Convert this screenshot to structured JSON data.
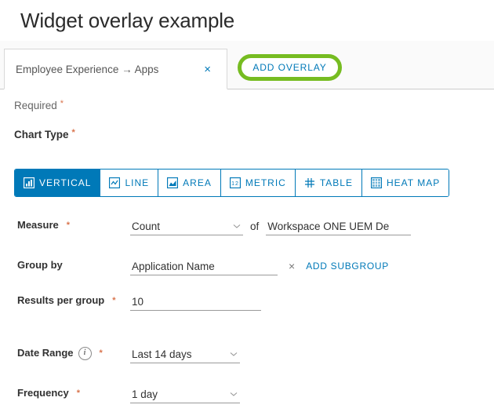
{
  "page": {
    "title": "Widget overlay example"
  },
  "tabs": {
    "active_label": "Employee Experience → Apps",
    "close_icon": "×",
    "add_overlay_label": "ADD OVERLAY",
    "highlight_color": "#76bc21",
    "accent_color": "#0079b8"
  },
  "form": {
    "required_note": "Required",
    "required_marker": "*",
    "chart_type_label": "Chart Type",
    "chart_types": [
      {
        "label": "VERTICAL",
        "icon": "bar-chart-icon",
        "selected": true
      },
      {
        "label": "LINE",
        "icon": "line-chart-icon",
        "selected": false
      },
      {
        "label": "AREA",
        "icon": "area-chart-icon",
        "selected": false
      },
      {
        "label": "METRIC",
        "icon": "metric-number-icon",
        "selected": false
      },
      {
        "label": "TABLE",
        "icon": "table-grid-icon",
        "selected": false
      },
      {
        "label": "HEAT MAP",
        "icon": "heat-map-icon",
        "selected": false
      }
    ],
    "measure": {
      "label": "Measure",
      "value": "Count",
      "of_text": "of",
      "target_value": "Workspace ONE UEM De"
    },
    "group_by": {
      "label": "Group by",
      "value": "Application Name",
      "clear_icon": "×",
      "add_subgroup_label": "ADD SUBGROUP"
    },
    "results_per_group": {
      "label": "Results per group",
      "value": "10"
    },
    "date_range": {
      "label": "Date Range",
      "info_icon": "i",
      "value": "Last 14 days"
    },
    "frequency": {
      "label": "Frequency",
      "value": "1 day"
    }
  }
}
